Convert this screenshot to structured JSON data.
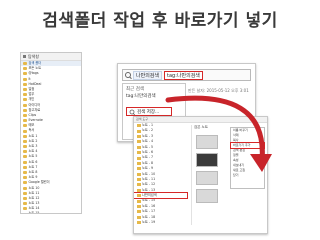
{
  "slide": {
    "title": "검색폴더 작업 후 바로가기 넣기"
  },
  "sidebar": {
    "header": "탐색창",
    "items": [
      {
        "label": "검색 폴더"
      },
      {
        "label": "모든 노트"
      },
      {
        "label": "@tags"
      },
      {
        "label": "lt"
      },
      {
        "label": "HotDeal"
      },
      {
        "label": "일정"
      },
      {
        "label": "업무"
      },
      {
        "label": "개인"
      },
      {
        "label": "아이디어"
      },
      {
        "label": "참고자료"
      },
      {
        "label": "Clips"
      },
      {
        "label": "Evernote"
      },
      {
        "label": "메모"
      },
      {
        "label": "독서"
      },
      {
        "label": "노트 1"
      },
      {
        "label": "노트 2"
      },
      {
        "label": "노트 3"
      },
      {
        "label": "노트 4"
      },
      {
        "label": "노트 5"
      },
      {
        "label": "노트 6"
      },
      {
        "label": "노트 7"
      },
      {
        "label": "노트 8"
      },
      {
        "label": "노트 9"
      },
      {
        "label": "Google 캘린더"
      },
      {
        "label": "노트 10"
      },
      {
        "label": "노트 11"
      },
      {
        "label": "노트 12"
      },
      {
        "label": "노트 13"
      },
      {
        "label": "노트 14"
      },
      {
        "label": "노트 15"
      }
    ]
  },
  "search": {
    "chip_label": "나만의검색",
    "active_query": "tag:나만의검색",
    "recent_caption": "최근 검색",
    "recent_item": "tag:나만의검색",
    "save_label": "검색 저장...",
    "info_text": "만든 날자: 2015-05-12 오후 3:01"
  },
  "tree": {
    "header": "검색 도구",
    "content_header": "검은 노트",
    "items": [
      {
        "label": "노트 - 1"
      },
      {
        "label": "노트 - 2"
      },
      {
        "label": "노트 - 3"
      },
      {
        "label": "노트 - 4"
      },
      {
        "label": "노트 - 5"
      },
      {
        "label": "노트 - 6"
      },
      {
        "label": "노트 - 7"
      },
      {
        "label": "노트 - 8"
      },
      {
        "label": "노트 - 9"
      },
      {
        "label": "노트 - 10"
      },
      {
        "label": "노트 - 11"
      },
      {
        "label": "노트 - 12"
      },
      {
        "label": "노트 - 13"
      },
      {
        "label": "나만의검색"
      },
      {
        "label": "노트 - 15"
      },
      {
        "label": "노트 - 16"
      },
      {
        "label": "노트 - 17"
      },
      {
        "label": "노트 - 18"
      },
      {
        "label": "노트 - 19"
      }
    ],
    "context_menu": [
      {
        "label": "이름 바꾸기"
      },
      {
        "label": "삭제"
      },
      {
        "label": "복사"
      },
      {
        "label": "바로가기 추가"
      },
      {
        "label": "검색 편집"
      },
      {
        "label": "정렬"
      },
      {
        "label": "속성"
      },
      {
        "label": "내보내기"
      },
      {
        "label": "새로 고침"
      },
      {
        "label": "닫기"
      }
    ]
  },
  "colors": {
    "highlight": "#d62828",
    "arrow": "#c8242a"
  }
}
